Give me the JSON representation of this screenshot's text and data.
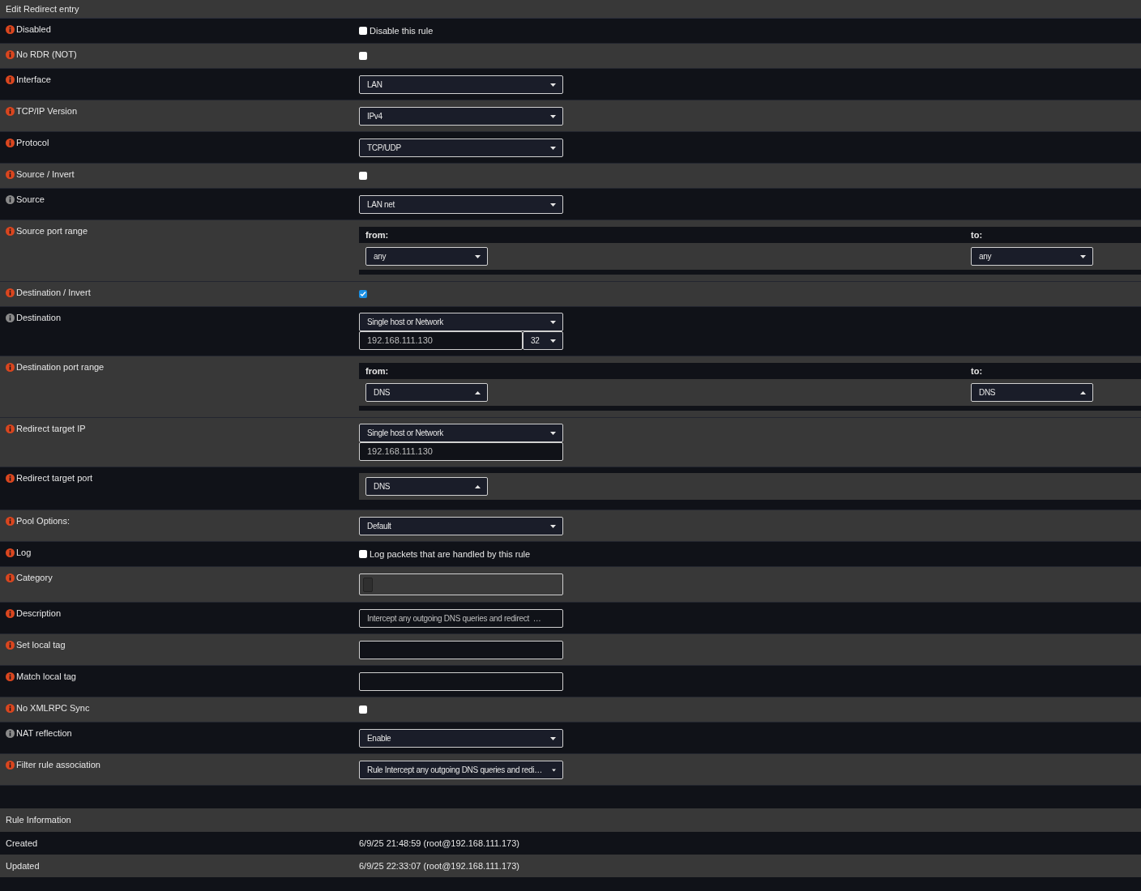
{
  "title": "Edit Redirect entry",
  "rows": [
    {
      "label": "Disabled",
      "color": "#d9461f",
      "shaded": false,
      "kind": "checkbox",
      "checked": false,
      "text": "Disable this rule"
    },
    {
      "label": "No RDR (NOT)",
      "color": "#d9461f",
      "shaded": true,
      "kind": "checkbox",
      "checked": false
    },
    {
      "label": "Interface",
      "color": "#d9461f",
      "shaded": false,
      "kind": "select",
      "value": "LAN"
    },
    {
      "label": "TCP/IP Version",
      "color": "#d9461f",
      "shaded": true,
      "kind": "select",
      "value": "IPv4"
    },
    {
      "label": "Protocol",
      "color": "#d9461f",
      "shaded": false,
      "kind": "select",
      "value": "TCP/UDP"
    },
    {
      "label": "Source / Invert",
      "color": "#d9461f",
      "shaded": true,
      "kind": "checkbox",
      "checked": false
    },
    {
      "label": "Source",
      "color": "#8a8a8a",
      "shaded": false,
      "kind": "select",
      "value": "LAN net"
    },
    {
      "label": "Source port range",
      "color": "#d9461f",
      "shaded": true,
      "kind": "portrange",
      "from_label": "from:",
      "to_label": "to:",
      "from": {
        "value": "any",
        "caret_up": false
      },
      "to": {
        "value": "any",
        "caret_up": false
      }
    },
    {
      "label": "Destination / Invert",
      "color": "#d9461f",
      "shaded": true,
      "kind": "checkbox",
      "checked": true
    },
    {
      "label": "Destination",
      "color": "#8a8a8a",
      "shaded": false,
      "kind": "network",
      "value": "Single host or Network",
      "address": "192.168.111.130",
      "mask": "32"
    },
    {
      "label": "Destination port range",
      "color": "#d9461f",
      "shaded": true,
      "kind": "portrange",
      "from_label": "from:",
      "to_label": "to:",
      "from": {
        "value": "DNS",
        "caret_up": true
      },
      "to": {
        "value": "DNS",
        "caret_up": true
      }
    },
    {
      "label": "Redirect target IP",
      "color": "#d9461f",
      "shaded": true,
      "kind": "network",
      "value": "Single host or Network",
      "address": "192.168.111.130"
    },
    {
      "label": "Redirect target port",
      "color": "#d9461f",
      "shaded": false,
      "kind": "port",
      "port": {
        "value": "DNS",
        "caret_up": true
      }
    },
    {
      "label": "Pool Options:",
      "color": "#d9461f",
      "shaded": true,
      "kind": "select",
      "value": "Default"
    },
    {
      "label": "Log",
      "color": "#d9461f",
      "shaded": false,
      "kind": "checkbox",
      "checked": false,
      "text": "Log packets that are handled by this rule"
    },
    {
      "label": "Category",
      "color": "#d9461f",
      "shaded": true,
      "kind": "tags"
    },
    {
      "label": "Description",
      "color": "#d9461f",
      "shaded": false,
      "kind": "input",
      "value": "Intercept any outgoing DNS queries and redirect  …"
    },
    {
      "label": "Set local tag",
      "color": "#d9461f",
      "shaded": true,
      "kind": "input"
    },
    {
      "label": "Match local tag",
      "color": "#d9461f",
      "shaded": false,
      "kind": "input"
    },
    {
      "label": "No XMLRPC Sync",
      "color": "#d9461f",
      "shaded": true,
      "kind": "checkbox",
      "checked": false
    },
    {
      "label": "NAT reflection",
      "color": "#8a8a8a",
      "shaded": false,
      "kind": "select",
      "value": "Enable"
    },
    {
      "label": "Filter rule association",
      "color": "#d9461f",
      "shaded": true,
      "kind": "select",
      "value": "Rule Intercept any outgoing DNS queries and redi…",
      "small_caret": true
    }
  ],
  "info_title": "Rule Information",
  "info_rows": [
    {
      "label": "Created",
      "value": "6/9/25 21:48:59 (root@192.168.111.173)"
    },
    {
      "label": "Updated",
      "value": "6/9/25 22:33:07 (root@192.168.111.173)"
    }
  ]
}
